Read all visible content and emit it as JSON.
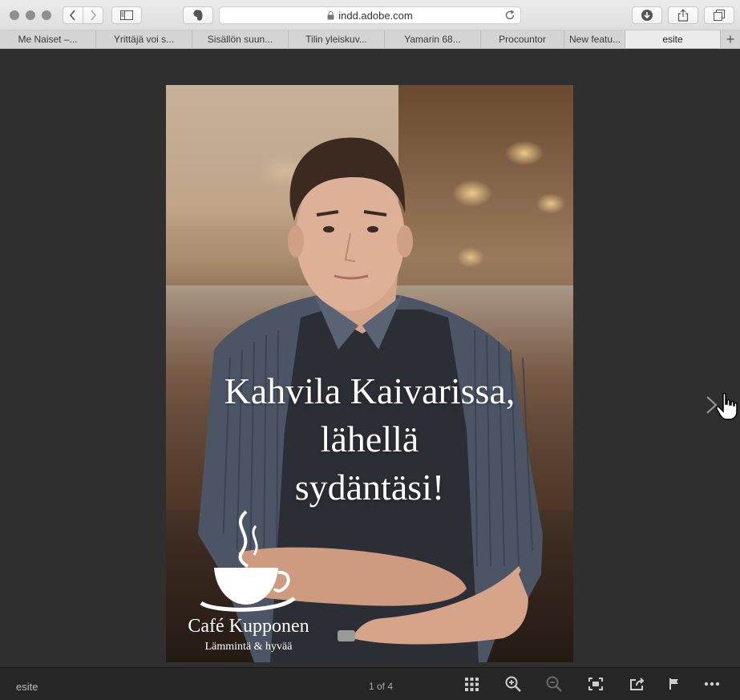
{
  "browser": {
    "url": "indd.adobe.com",
    "tabs": [
      {
        "label": "Me Naiset –...",
        "active": false
      },
      {
        "label": "Yrittäjä voi s...",
        "active": false
      },
      {
        "label": "Sisällön suun...",
        "active": false
      },
      {
        "label": "Tilin yleiskuv...",
        "active": false
      },
      {
        "label": "Yamarin 68...",
        "active": false
      },
      {
        "label": "Procountor",
        "active": false
      },
      {
        "label": "New featu...",
        "active": false
      },
      {
        "label": "esite",
        "active": true
      }
    ],
    "icons": {
      "back": "chevron-left-icon",
      "forward": "chevron-right-icon",
      "sidebar": "sidebar-icon",
      "evernote": "evernote-elephant-icon",
      "lock": "lock-icon",
      "reload": "reload-icon",
      "download": "download-icon",
      "share": "share-icon",
      "tabs": "tab-overview-icon",
      "new_tab": "plus-icon"
    }
  },
  "document": {
    "headline": [
      "Kahvila Kaivarissa,",
      "lähellä",
      "sydäntäsi!"
    ],
    "brand_name": "Café Kupponen",
    "brand_tagline": "Lämmintä & hyvää"
  },
  "viewer": {
    "doc_name": "esite",
    "page_indicator": "1 of 4",
    "toolbar_icons": [
      "grid-icon",
      "zoom-in-icon",
      "zoom-out-icon",
      "fit-screen-icon",
      "share-icon",
      "flag-icon",
      "more-icon"
    ]
  }
}
